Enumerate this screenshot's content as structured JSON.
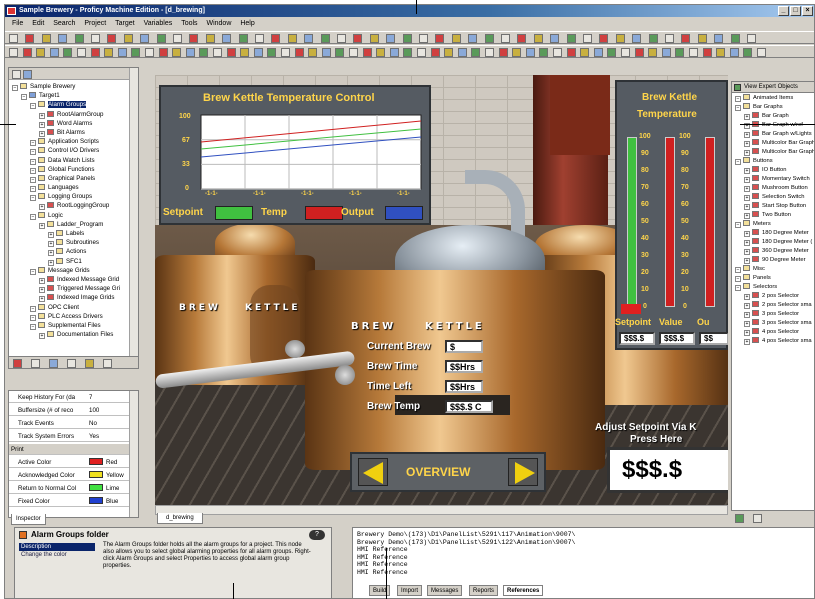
{
  "window": {
    "title": "Sample Brewery - Proficy Machine Edition - [d_brewing]"
  },
  "menu": [
    "File",
    "Edit",
    "Search",
    "Project",
    "Target",
    "Variables",
    "Tools",
    "Window",
    "Help"
  ],
  "navigator": {
    "items": [
      {
        "label": "Sample Brewery",
        "level": 0,
        "icon": "folder"
      },
      {
        "label": "Target1",
        "level": 1,
        "icon": "target"
      },
      {
        "label": "Alarm Groups",
        "level": 2,
        "icon": "folder",
        "selected": true
      },
      {
        "label": "RootAlarmGroup",
        "level": 3,
        "icon": "alarm"
      },
      {
        "label": "Word Alarms",
        "level": 3,
        "icon": "alarm"
      },
      {
        "label": "Bit Alarms",
        "level": 3,
        "icon": "alarm"
      },
      {
        "label": "Application Scripts",
        "level": 2,
        "icon": "folder"
      },
      {
        "label": "Control I/O Drivers",
        "level": 2,
        "icon": "folder"
      },
      {
        "label": "Data Watch Lists",
        "level": 2,
        "icon": "folder"
      },
      {
        "label": "Global Functions",
        "level": 2,
        "icon": "folder"
      },
      {
        "label": "Graphical Panels",
        "level": 2,
        "icon": "folder"
      },
      {
        "label": "Languages",
        "level": 2,
        "icon": "folder"
      },
      {
        "label": "Logging Groups",
        "level": 2,
        "icon": "folder"
      },
      {
        "label": "RootLoggingGroup",
        "level": 3,
        "icon": "alarm"
      },
      {
        "label": "Logic",
        "level": 2,
        "icon": "folder"
      },
      {
        "label": "Ladder_Program",
        "level": 3,
        "icon": "folder"
      },
      {
        "label": "Labels",
        "level": 4,
        "icon": "folder"
      },
      {
        "label": "Subroutines",
        "level": 4,
        "icon": "folder"
      },
      {
        "label": "Actions",
        "level": 4,
        "icon": "folder"
      },
      {
        "label": "SFC1",
        "level": 4,
        "icon": "folder"
      },
      {
        "label": "Message Grids",
        "level": 2,
        "icon": "folder"
      },
      {
        "label": "Indexed Message Grid",
        "level": 3,
        "icon": "alarm"
      },
      {
        "label": "Triggered Message Gri",
        "level": 3,
        "icon": "alarm"
      },
      {
        "label": "Indexed Image Grids",
        "level": 3,
        "icon": "alarm"
      },
      {
        "label": "OPC Client",
        "level": 2,
        "icon": "folder"
      },
      {
        "label": "PLC Access Drivers",
        "level": 2,
        "icon": "folder"
      },
      {
        "label": "Supplemental Files",
        "level": 2,
        "icon": "folder"
      },
      {
        "label": "Documentation Files",
        "level": 3,
        "icon": "folder"
      }
    ]
  },
  "inspector": {
    "tab": "Inspector",
    "rows": [
      {
        "key": "Keep History For (da",
        "value": "7"
      },
      {
        "key": "Buffersize (# of reco",
        "value": "100"
      },
      {
        "key": "Track Events",
        "value": "No"
      },
      {
        "key": "Track System Errors",
        "value": "Yes"
      },
      {
        "key": "Print",
        "value": "",
        "section": true
      },
      {
        "key": "Active Color",
        "value": "Red",
        "color": "#e02020"
      },
      {
        "key": "Acknowledged Color",
        "value": "Yellow",
        "color": "#f0e020"
      },
      {
        "key": "Return to Normal Col",
        "value": "Lime",
        "color": "#40e040"
      },
      {
        "key": "Fixed Color",
        "value": "Blue",
        "color": "#2040d0"
      }
    ]
  },
  "help": {
    "title": "Alarm Groups folder",
    "links": [
      "Description",
      "Change the color"
    ],
    "text": "The Alarm Groups folder holds all the alarm groups for a project. This node also allows you to select global alarming properties for all alarm groups. Right-click Alarm Groups and select Properties to access global alarm group properties."
  },
  "panel": {
    "chart_title": "Brew Kettle Temperature Control",
    "y_ticks": [
      "100",
      "67",
      "33",
      "0"
    ],
    "x_ticks": [
      "-1-1-",
      "-1-1-",
      "-1-1-",
      "-1-1-",
      "-1-1-"
    ],
    "legend": [
      "Setpoint",
      "Temp",
      "Output"
    ],
    "legend_colors": [
      "#40c040",
      "#d02020",
      "#3050c0"
    ],
    "kettle_left": [
      "BREW",
      "KETTLE"
    ],
    "kettle_center": [
      "BREW",
      "KETTLE"
    ],
    "fields": [
      {
        "label": "Current Brew",
        "value": "$"
      },
      {
        "label": "Brew Time",
        "value": "$$Hrs"
      },
      {
        "label": "Time Left",
        "value": "$$Hrs"
      },
      {
        "label": "Brew Temp",
        "value": "$$$.$ C"
      }
    ],
    "overview": "OVERVIEW",
    "adjust_text": [
      "Adjust Setpoint Via K",
      "Press Here"
    ],
    "big_value": "$$$.$",
    "temp_title": [
      "Brew Kettle",
      "Temperature"
    ],
    "scale": [
      "100",
      "90",
      "80",
      "70",
      "60",
      "50",
      "40",
      "30",
      "20",
      "10",
      "0"
    ],
    "meter_labels": [
      "Setpoint",
      "Value",
      "Ou"
    ],
    "meter_values": [
      "$$$.$",
      "$$$.$",
      "$$"
    ]
  },
  "doc_tab": "d_brewing",
  "objects": {
    "header": "View Expert Objects",
    "items": [
      {
        "label": "Animated Items",
        "level": 0,
        "group": true
      },
      {
        "label": "Bar Graphs",
        "level": 0,
        "group": true
      },
      {
        "label": "Bar Graph",
        "level": 1
      },
      {
        "label": "Bar Graph w/ref",
        "level": 1
      },
      {
        "label": "Bar Graph w/Lights",
        "level": 1
      },
      {
        "label": "Multicolor Bar Graph",
        "level": 1
      },
      {
        "label": "Multicolor Bar Graph",
        "level": 1
      },
      {
        "label": "Buttons",
        "level": 0,
        "group": true
      },
      {
        "label": "IO Button",
        "level": 1
      },
      {
        "label": "Momentary Switch",
        "level": 1
      },
      {
        "label": "Mushroom Button",
        "level": 1
      },
      {
        "label": "Selection Switch",
        "level": 1
      },
      {
        "label": "Start Stop Button",
        "level": 1
      },
      {
        "label": "Two Button",
        "level": 1
      },
      {
        "label": "Meters",
        "level": 0,
        "group": true
      },
      {
        "label": "180 Degree Meter",
        "level": 1
      },
      {
        "label": "180 Degree Meter (",
        "level": 1
      },
      {
        "label": "360 Degree Meter",
        "level": 1
      },
      {
        "label": "90 Degree Meter",
        "level": 1
      },
      {
        "label": "Misc",
        "level": 0,
        "group": true
      },
      {
        "label": "Panels",
        "level": 0,
        "group": true
      },
      {
        "label": "Selectors",
        "level": 0,
        "group": true
      },
      {
        "label": "2 pos Selector",
        "level": 1
      },
      {
        "label": "2 pos Selector sma",
        "level": 1
      },
      {
        "label": "3 pos Selector",
        "level": 1
      },
      {
        "label": "3 pos Selector sma",
        "level": 1
      },
      {
        "label": "4 pos Selector",
        "level": 1
      },
      {
        "label": "4 pos Selector sma",
        "level": 1
      }
    ]
  },
  "output": {
    "lines": [
      "Brewery Demo\\(173)\\D1\\PanelList\\5291\\117\\Animation\\9007\\",
      "Brewery Demo\\(173)\\D1\\PanelList\\5291\\122\\Animation\\9007\\",
      "HMI Reference",
      "HMI Reference",
      "HMI Reference",
      "HMI Reference"
    ],
    "tabs": [
      "Build",
      "Import",
      "Messages",
      "Reports",
      "References"
    ]
  }
}
